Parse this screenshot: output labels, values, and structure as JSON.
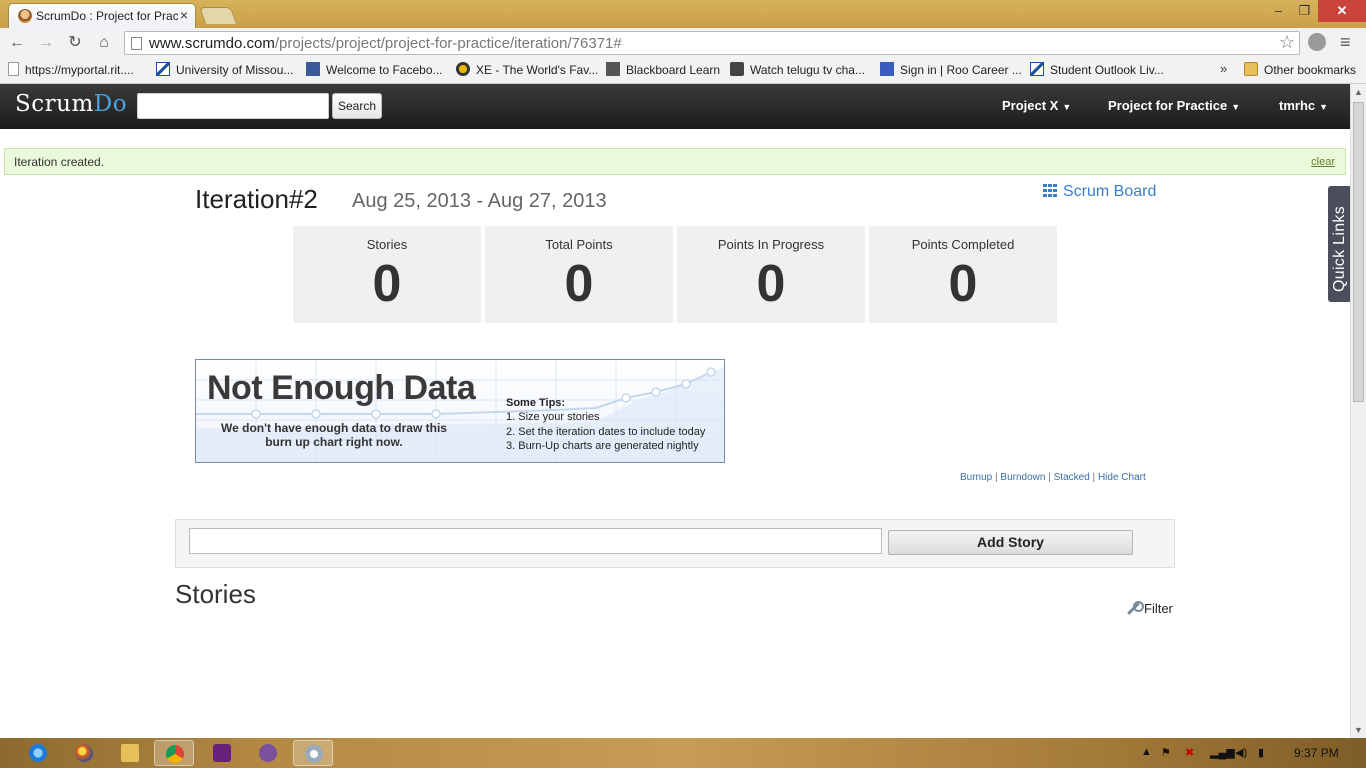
{
  "browser": {
    "tab_title": "ScrumDo : Project for Prac",
    "url_host": "www.scrumdo.com",
    "url_path": "/projects/project/project-for-practice/iteration/76371#",
    "bookmarks": [
      "https://myportal.rit....",
      "University of Missou...",
      "Welcome to Facebo...",
      "XE - The World's Fav...",
      "Blackboard Learn",
      "Watch telugu tv cha...",
      "Sign in | Roo Career ...",
      "Student Outlook Liv...",
      "Other bookmarks"
    ],
    "more_bookmarks": "»"
  },
  "app": {
    "logo_scrum": "Scrum",
    "logo_do": "Do",
    "search_button": "Search",
    "nav": {
      "project_x": "Project X",
      "project_practice": "Project for Practice",
      "user": "tmrhc"
    },
    "flash": {
      "message": "Iteration created.",
      "clear": "clear"
    },
    "iteration": {
      "title": "Iteration#2",
      "dates": "Aug 25, 2013 - Aug 27, 2013",
      "scrum_board": "Scrum Board"
    },
    "stats": [
      {
        "label": "Stories",
        "value": "0"
      },
      {
        "label": "Total Points",
        "value": "0"
      },
      {
        "label": "Points In Progress",
        "value": "0"
      },
      {
        "label": "Points Completed",
        "value": "0"
      }
    ],
    "quick_links": "Quick Links",
    "chart_placeholder": {
      "heading": "Not Enough Data",
      "message": "We don't have enough data to draw this burn up chart right now.",
      "tips_heading": "Some Tips:",
      "tips": [
        "1. Size your stories",
        "2. Set the iteration dates to include today",
        "3. Burn-Up charts are generated nightly"
      ]
    },
    "chart_links": [
      "Burnup",
      "Burndown",
      "Stacked",
      "Hide Chart"
    ],
    "add_story_button": "Add Story",
    "stories_heading": "Stories",
    "filter": "Filter"
  },
  "taskbar": {
    "clock": "9:37 PM"
  }
}
